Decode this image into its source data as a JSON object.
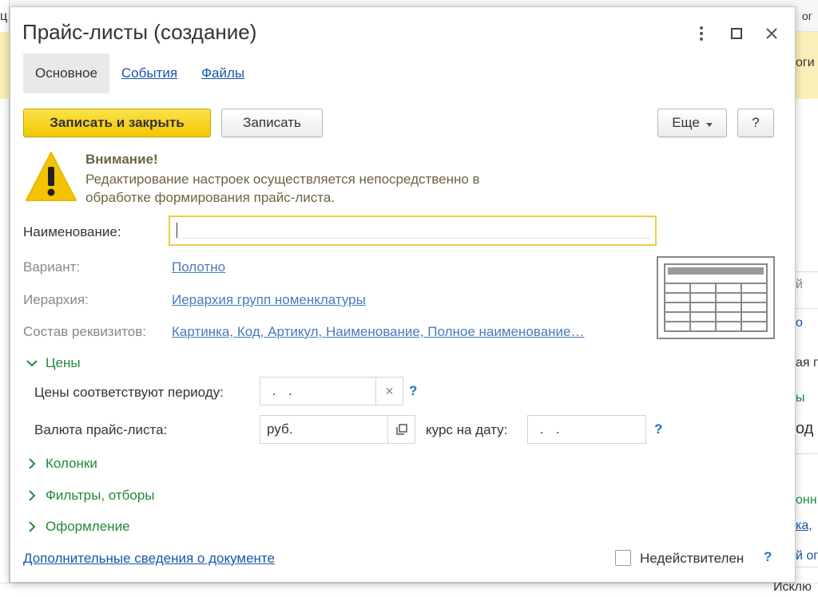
{
  "window": {
    "title": "Прайс-листы (создание)"
  },
  "tabs": [
    {
      "label": "Основное"
    },
    {
      "label": "События"
    },
    {
      "label": "Файлы"
    }
  ],
  "toolbar": {
    "save_close_label": "Записать и закрыть",
    "save_label": "Записать",
    "more_label": "Еще",
    "help_label": "?"
  },
  "warning": {
    "title": "Внимание!",
    "text_line1": "Редактирование настроек осуществляется непосредственно в",
    "text_line2": "обработке формирования прайс-листа."
  },
  "form": {
    "name_label": "Наименование:",
    "name_value": "",
    "variant_label": "Вариант:",
    "variant_value": "Полотно",
    "hierarchy_label": "Иерархия:",
    "hierarchy_value": "Иерархия групп номенклатуры",
    "requisites_label": "Состав реквизитов:",
    "requisites_value": "Картинка, Код, Артикул, Наименование, Полное наименование…"
  },
  "prices_group": {
    "label": "Цены",
    "period_label": "Цены соответствуют периоду:",
    "period_value": " .  .",
    "period_clear": "×",
    "period_help": "?",
    "currency_label": "Валюта прайс-листа:",
    "currency_value": "руб.",
    "rate_label": "курс на дату:",
    "rate_value": " .  .",
    "rate_help": "?"
  },
  "collapsed_groups": [
    {
      "label": "Колонки"
    },
    {
      "label": "Фильтры, отборы"
    },
    {
      "label": "Оформление"
    }
  ],
  "footer": {
    "additional_link": "Дополнительные сведения о документе",
    "invalid_label": "Недействителен",
    "invalid_checked": false,
    "invalid_help": "?"
  },
  "background": {
    "right_fragments": [
      "й",
      "о",
      "ая п",
      "ы",
      "од",
      "онн",
      "ка,",
      "й оп",
      "Исклю"
    ],
    "top_fragments": [
      "ц",
      "ог",
      "оги"
    ]
  }
}
